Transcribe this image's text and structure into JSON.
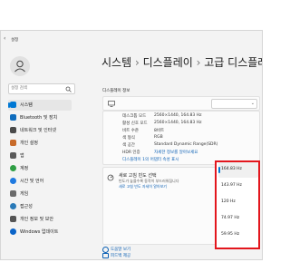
{
  "window": {
    "title": "설정"
  },
  "profile": {
    "avatar_icon": "user-icon"
  },
  "search": {
    "placeholder": "설정 검색"
  },
  "sidebar": {
    "items": [
      {
        "label": "시스템",
        "icon": "monitor-icon",
        "color": "#0078d4"
      },
      {
        "label": "Bluetooth 및 장치",
        "icon": "bluetooth-icon",
        "color": "#0f6cbd"
      },
      {
        "label": "네트워크 및 인터넷",
        "icon": "network-icon",
        "color": "#4a4a4a"
      },
      {
        "label": "개인 설정",
        "icon": "brush-icon",
        "color": "#c86b2a"
      },
      {
        "label": "앱",
        "icon": "apps-icon",
        "color": "#5a5a5a"
      },
      {
        "label": "계정",
        "icon": "account-icon",
        "color": "#2f9e44"
      },
      {
        "label": "시간 및 언어",
        "icon": "globe-icon",
        "color": "#1f7ae0"
      },
      {
        "label": "게임",
        "icon": "game-icon",
        "color": "#6b6b6b"
      },
      {
        "label": "접근성",
        "icon": "accessibility-icon",
        "color": "#2a7ab8"
      },
      {
        "label": "개인 정보 및 보안",
        "icon": "shield-icon",
        "color": "#555555"
      },
      {
        "label": "Windows 업데이트",
        "icon": "update-icon",
        "color": "#0a64c8"
      }
    ]
  },
  "breadcrumb": {
    "part1": "시스템",
    "sep1": "›",
    "part2": "디스플레이",
    "sep2": "›",
    "part3": "고급 디스플레이"
  },
  "section": {
    "title": "디스플레이 정보"
  },
  "details": [
    {
      "label": "데스크톱 모드",
      "value": "2560×1440, 164.83 Hz"
    },
    {
      "label": "활성 신호 모드",
      "value": "2560×1440, 164.83 Hz"
    },
    {
      "label": "비트 수준",
      "value": "8비트"
    },
    {
      "label": "색 형식",
      "value": "RGB"
    },
    {
      "label": "색 공간",
      "value": "Standard Dynamic Range(SDR)"
    },
    {
      "label": "HDR 인증",
      "value": "자세한 정보를 알아보세요"
    }
  ],
  "adapter_link": "디스플레이 1의 어댑터 속성 표시",
  "refresh": {
    "title": "새로 고침 빈도 선택",
    "desc1": "빈도가 높을수록 동작이 부드러워집니다",
    "desc2": "새로 고침 빈도 자세히 알아보기",
    "options": [
      "164.83 Hz",
      "143.97 Hz",
      "120 Hz",
      "74.97 Hz",
      "59.95 Hz"
    ],
    "selected": "164.83 Hz"
  },
  "footer": {
    "help": "도움말 보기",
    "feedback": "피드백 제공"
  },
  "colors": {
    "highlight": "#e3161d",
    "accent": "#0078d4"
  }
}
